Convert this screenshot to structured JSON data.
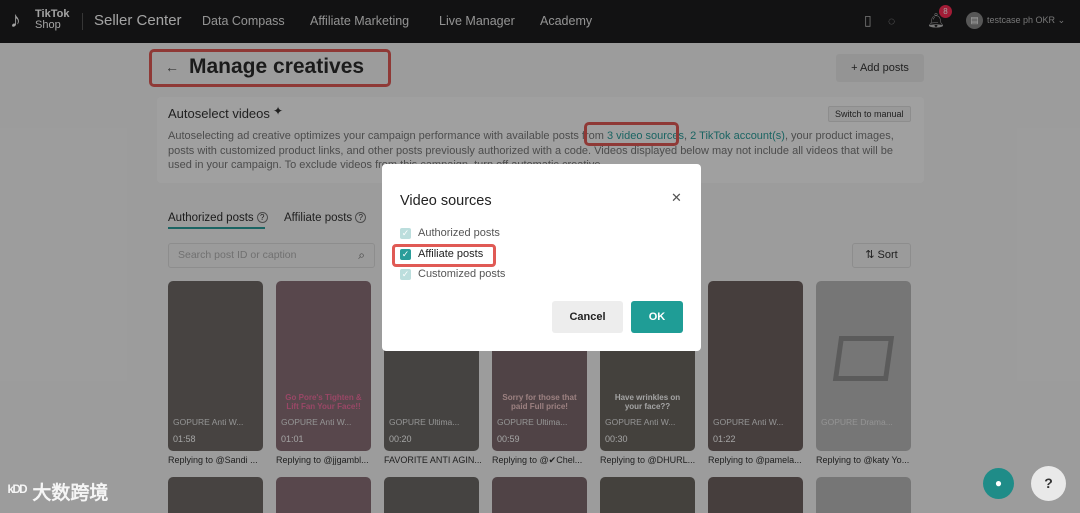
{
  "topbar": {
    "logo_line1": "TikTok",
    "logo_line2": "Shop",
    "brand": "Seller Center",
    "nav": [
      "Data Compass",
      "Affiliate Marketing",
      "Live Manager",
      "Academy"
    ],
    "notification_count": "8",
    "account": "testcase ph OKR"
  },
  "page": {
    "back_icon": "←",
    "title": "Manage creatives",
    "add_posts_label": "+ Add posts"
  },
  "autoselect": {
    "title": "Autoselect videos",
    "sparkle": "✦",
    "switch_label": "Switch to manual",
    "desc_part1": "Autoselecting ad creative optimizes your campaign performance with available posts from ",
    "link_sources": "3 video sources",
    "desc_comma": ", ",
    "link_accounts": "2 TikTok account(s)",
    "desc_part2": ", your product images, posts with customized product links, and other posts previously authorized with a code. Videos displayed below may not include all videos that will be used in your campaign. To exclude videos from this campaign, turn off automatic creative."
  },
  "tabs": {
    "authorized": "Authorized posts",
    "affiliate": "Affiliate posts",
    "help": "?"
  },
  "search": {
    "placeholder": "Search post ID or caption"
  },
  "sort_label": "⇅ Sort",
  "tiles": [
    {
      "name": "GOPURE Anti W...",
      "duration": "01:58",
      "caption": "Replying to @Sandi ...",
      "color": "#6f6a66",
      "overlay": ""
    },
    {
      "name": "GOPURE Anti W...",
      "duration": "01:01",
      "caption": "Replying to @jjgambl...",
      "color": "#8a6f77",
      "overlay": "Go Pore's Tighten & Lift Fan Your Face!!"
    },
    {
      "name": "GOPURE Ultima...",
      "duration": "00:20",
      "caption": "FAVORITE ANTI AGIN...",
      "color": "#6c6a66",
      "overlay": ""
    },
    {
      "name": "GOPURE Ultima...",
      "duration": "00:59",
      "caption": "Replying to @✔Chel...",
      "color": "#7d6a6e",
      "overlay": "Sorry for those that paid Full price!"
    },
    {
      "name": "GOPURE Anti W...",
      "duration": "00:30",
      "caption": "Replying to @DHURL...",
      "color": "#6b6660",
      "overlay": "Have wrinkles on your face??"
    },
    {
      "name": "GOPURE Anti W...",
      "duration": "01:22",
      "caption": "Replying to @pamela...",
      "color": "#6e6160",
      "overlay": ""
    },
    {
      "name": "GOPURE Drama...",
      "duration": "",
      "caption": "Replying to @katy Yo...",
      "color": "#b9b9b9",
      "overlay": ""
    }
  ],
  "modal": {
    "title": "Video sources",
    "close_icon": "✕",
    "options": [
      {
        "label": "Authorized posts",
        "state": "disabled-checked"
      },
      {
        "label": "Affiliate posts",
        "state": "checked"
      },
      {
        "label": "Customized posts",
        "state": "disabled-checked"
      }
    ],
    "cancel_label": "Cancel",
    "ok_label": "OK"
  },
  "help_fab": "?",
  "watermark": {
    "logo": "ᵏᴰᴰ",
    "text": "大数跨境"
  }
}
